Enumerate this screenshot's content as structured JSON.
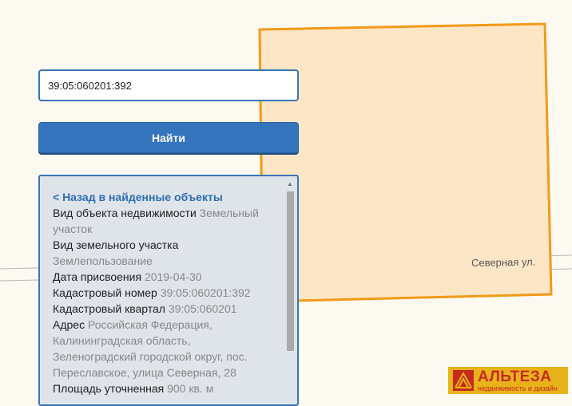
{
  "map": {
    "street_label": "Северная ул.",
    "parcel_fill": "#fde6c6",
    "parcel_stroke": "#f19a19"
  },
  "search": {
    "value": "39:05:060201:392",
    "button_label": "Найти"
  },
  "info_panel": {
    "back_link": "< Назад в найденные объекты",
    "rows": [
      {
        "key": "Вид объекта недвижимости",
        "value": "Земельный участок"
      },
      {
        "key": "Вид земельного участка",
        "value": "Землепользование"
      },
      {
        "key": "Дата присвоения",
        "value": "2019-04-30"
      },
      {
        "key": "Кадастровый номер",
        "value": "39:05:060201:392"
      },
      {
        "key": "Кадастровый квартал",
        "value": "39:05:060201"
      },
      {
        "key": "Адрес",
        "value": "Российская Федерация, Калининградская область, Зеленоградский городской округ, пос. Переславское, улица Северная, 28"
      },
      {
        "key": "Площадь уточненная",
        "value": "900 кв. м"
      }
    ]
  },
  "logo": {
    "name": "АЛЬТЕЗА",
    "tagline": "недвижимость и дизайн",
    "background": "#e8b31a",
    "text_color": "#c62a1c"
  }
}
